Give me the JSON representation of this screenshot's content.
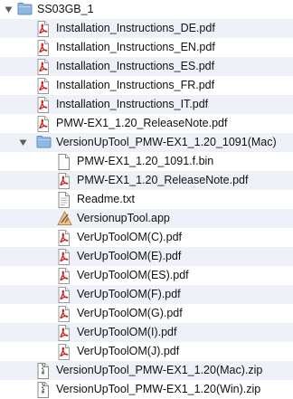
{
  "items": [
    {
      "label": "SS03GB_1",
      "icon": "folder-icon",
      "level": 0,
      "expanded": true
    },
    {
      "label": "Installation_Instructions_DE.pdf",
      "icon": "pdf-icon",
      "level": 1
    },
    {
      "label": "Installation_Instructions_EN.pdf",
      "icon": "pdf-icon",
      "level": 1
    },
    {
      "label": "Installation_Instructions_ES.pdf",
      "icon": "pdf-icon",
      "level": 1
    },
    {
      "label": "Installation_Instructions_FR.pdf",
      "icon": "pdf-icon",
      "level": 1
    },
    {
      "label": "Installation_Instructions_IT.pdf",
      "icon": "pdf-icon",
      "level": 1
    },
    {
      "label": "PMW-EX1_1.20_ReleaseNote.pdf",
      "icon": "pdf-icon",
      "level": 1
    },
    {
      "label": "VersionUpTool_PMW-EX1_1.20_1091(Mac)",
      "icon": "folder-icon",
      "level": 1,
      "expanded": true
    },
    {
      "label": "PMW-EX1_1.20_1091.f.bin",
      "icon": "document-icon",
      "level": 2
    },
    {
      "label": "PMW-EX1_1.20_ReleaseNote.pdf",
      "icon": "pdf-icon",
      "level": 2
    },
    {
      "label": "Readme.txt",
      "icon": "text-file-icon",
      "level": 2
    },
    {
      "label": "VersionupTool.app",
      "icon": "app-icon",
      "level": 2
    },
    {
      "label": "VerUpToolOM(C).pdf",
      "icon": "pdf-icon",
      "level": 2
    },
    {
      "label": "VerUpToolOM(E).pdf",
      "icon": "pdf-icon",
      "level": 2
    },
    {
      "label": "VerUpToolOM(ES).pdf",
      "icon": "pdf-icon",
      "level": 2
    },
    {
      "label": "VerUpToolOM(F).pdf",
      "icon": "pdf-icon",
      "level": 2
    },
    {
      "label": "VerUpToolOM(G).pdf",
      "icon": "pdf-icon",
      "level": 2
    },
    {
      "label": "VerUpToolOM(I).pdf",
      "icon": "pdf-icon",
      "level": 2
    },
    {
      "label": "VerUpToolOM(J).pdf",
      "icon": "pdf-icon",
      "level": 2
    },
    {
      "label": "VersionUpTool_PMW-EX1_1.20(Mac).zip",
      "icon": "zip-icon",
      "level": 1
    },
    {
      "label": "VersionUpTool_PMW-EX1_1.20(Win).zip",
      "icon": "zip-icon",
      "level": 1
    }
  ],
  "colors": {
    "row_alt": "#eef2f8",
    "folder": "#8fb8e0",
    "pdf_red": "#c9231b",
    "disclosure": "#5a5a5a"
  }
}
